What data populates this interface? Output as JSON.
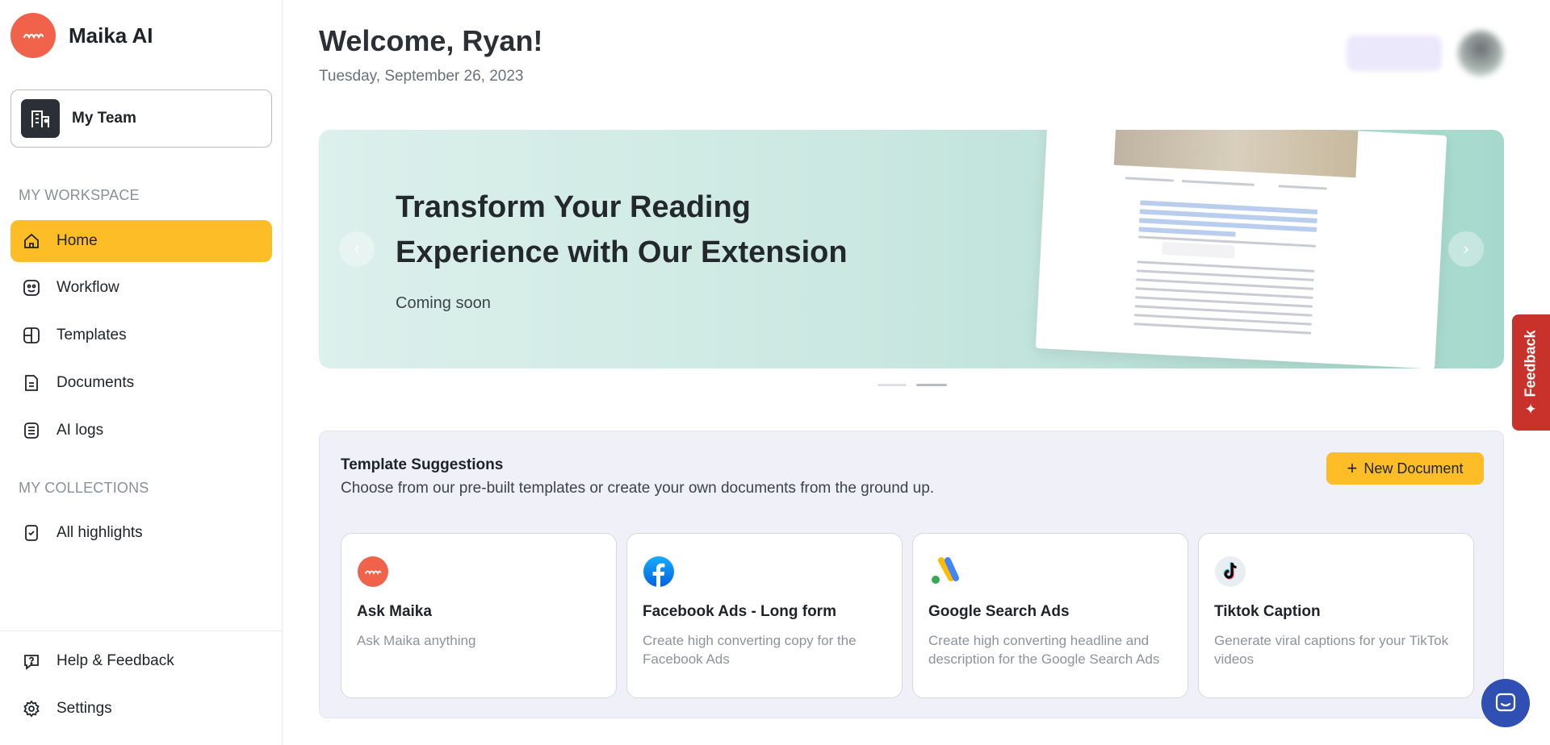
{
  "brand": {
    "name": "Maika AI"
  },
  "team": {
    "label": "My Team"
  },
  "sidebar": {
    "workspace_label": "MY WORKSPACE",
    "items": [
      {
        "label": "Home"
      },
      {
        "label": "Workflow"
      },
      {
        "label": "Templates"
      },
      {
        "label": "Documents"
      },
      {
        "label": "AI logs"
      }
    ],
    "collections_label": "MY COLLECTIONS",
    "collections": [
      {
        "label": "All highlights"
      }
    ],
    "footer": [
      {
        "label": "Help & Feedback"
      },
      {
        "label": "Settings"
      }
    ]
  },
  "header": {
    "welcome": "Welcome, Ryan!",
    "date": "Tuesday, September 26, 2023"
  },
  "banner": {
    "title": "Transform Your Reading Experience with Our Extension",
    "subtitle": "Coming soon",
    "active_slide": 2,
    "slide_count": 2
  },
  "feedback_tab": {
    "label": "Feedback"
  },
  "suggestions": {
    "title": "Template Suggestions",
    "subtitle": "Choose from our pre-built templates or create your own documents from the ground up.",
    "new_document_label": "New Document",
    "cards": [
      {
        "title": "Ask Maika",
        "description": "Ask Maika anything",
        "icon": "maika-logo-icon"
      },
      {
        "title": "Facebook Ads - Long form",
        "description": "Create high converting copy for the Facebook Ads",
        "icon": "facebook-icon"
      },
      {
        "title": "Google Search Ads",
        "description": "Create high converting headline and description for the Google Search Ads",
        "icon": "google-ads-icon"
      },
      {
        "title": "Tiktok Caption",
        "description": "Generate viral captions for your TikTok videos",
        "icon": "tiktok-icon"
      }
    ]
  },
  "colors": {
    "accent": "#fcbd26",
    "brand": "#f0634a",
    "feedback": "#c8322b",
    "chat": "#2f4fb2"
  }
}
